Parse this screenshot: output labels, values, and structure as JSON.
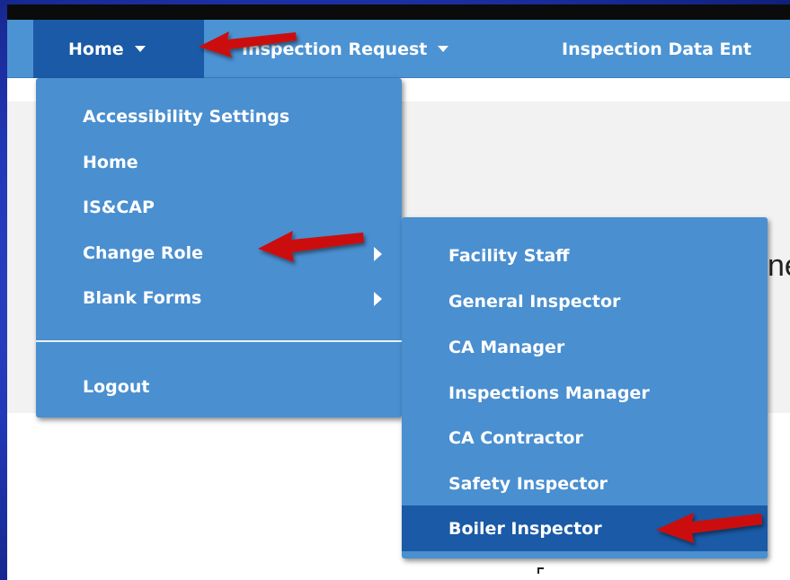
{
  "navbar": {
    "items": [
      {
        "label": "Home"
      },
      {
        "label": "Inspection Request"
      },
      {
        "label": "Inspection Data Ent"
      }
    ]
  },
  "home_menu": {
    "items": [
      {
        "label": "Accessibility Settings"
      },
      {
        "label": "Home"
      },
      {
        "label": "IS&CAP"
      },
      {
        "label": "Change Role",
        "has_submenu": true
      },
      {
        "label": "Blank Forms",
        "has_submenu": true
      }
    ],
    "logout_label": "Logout"
  },
  "role_submenu": {
    "items": [
      {
        "label": "Facility Staff"
      },
      {
        "label": "General Inspector"
      },
      {
        "label": "CA Manager"
      },
      {
        "label": "Inspections Manager"
      },
      {
        "label": "CA Contractor"
      },
      {
        "label": "Safety Inspector"
      },
      {
        "label": "Boiler Inspector",
        "selected": true
      }
    ]
  },
  "background": {
    "partial_heading": "ne"
  },
  "colors": {
    "navbar": "#4c93d3",
    "menu": "#4a8fd0",
    "active": "#1a5aa6",
    "annotation_arrow": "#cc1111",
    "slide_frame": "#2238b8"
  },
  "icons": {
    "dropdown_caret": "caret-down-icon",
    "submenu_indicator": "caret-right-icon",
    "annotation": "red-arrow-icon"
  }
}
